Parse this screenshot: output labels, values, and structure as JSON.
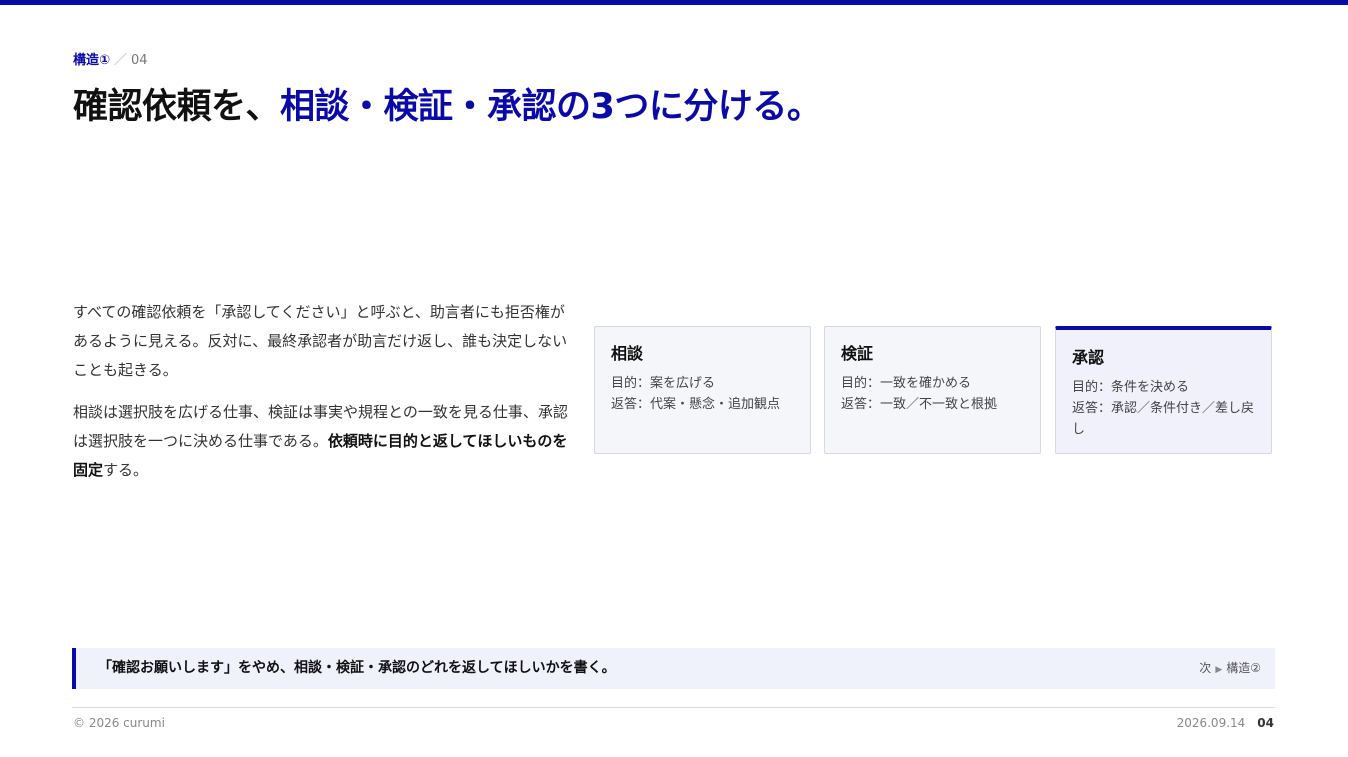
{
  "header": {
    "section_label": "構造①",
    "separator": "／",
    "slide_number": "04",
    "title_part1": "確認依頼を、",
    "title_part2": "相談・検証・承認の3つに分ける。"
  },
  "body": {
    "paragraph1": "すべての確認依頼を「承認してください」と呼ぶと、助言者にも拒否権があるように見える。反対に、最終承認者が助言だけ返し、誰も決定しないことも起きる。",
    "paragraph2_prefix": "相談は選択肢を広げる仕事、検証は事実や規程との一致を見る仕事、承認は選択肢を一つに決める仕事である。",
    "paragraph2_bold": "依頼時に目的と返してほしいものを固定",
    "paragraph2_suffix": "する。"
  },
  "cards": [
    {
      "title": "相談",
      "purpose": "目的：案を広げる",
      "reply": "返答：代案・懸念・追加観点"
    },
    {
      "title": "検証",
      "purpose": "目的：一致を確かめる",
      "reply": "返答：一致／不一致と根拠"
    },
    {
      "title": "承認",
      "purpose": "目的：条件を決める",
      "reply": "返答：承認／条件付き／差し戻し"
    }
  ],
  "callout": {
    "text": "「確認お願いします」をやめ、相談・検証・承認のどれを返してほしいかを書く。",
    "next_prefix": "次",
    "next_arrow": "▶",
    "next_label": "構造②"
  },
  "footer": {
    "copyright": "© 2026 curumi",
    "date": "2026.09.14",
    "page": "04"
  },
  "colors": {
    "accent": "#0a0aa8",
    "callout_bg": "#f0f2fb",
    "card_bg": "#f5f6fa"
  }
}
